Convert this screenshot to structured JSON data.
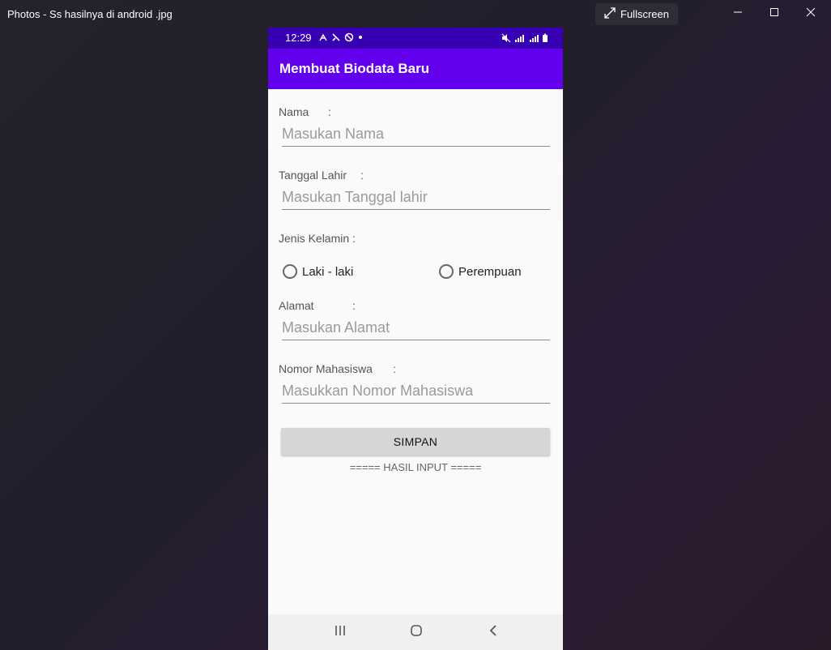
{
  "window": {
    "title": "Photos - Ss hasilnya di android .jpg",
    "fullscreen_label": "Fullscreen",
    "controls": [
      "minimize-icon",
      "maximize-icon",
      "close-icon"
    ]
  },
  "phone": {
    "status_bar": {
      "time": "12:29",
      "left_icons": [
        "accessibility-icon",
        "tools-icon",
        "sync-icon",
        "dot-icon"
      ],
      "right_icons": [
        "mute-icon",
        "signal-icon",
        "4g-signal-icon",
        "battery-icon"
      ]
    },
    "app_bar": {
      "title": "Membuat Biodata Baru"
    },
    "form": {
      "nama": {
        "label": "Nama",
        "colon": ":",
        "placeholder": "Masukan Nama",
        "value": ""
      },
      "tanggal_lahir": {
        "label": "Tanggal Lahir",
        "colon": ":",
        "placeholder": "Masukan Tanggal lahir",
        "value": ""
      },
      "jenis_kelamin": {
        "label": "Jenis Kelamin :",
        "options": [
          {
            "label": "Laki - laki",
            "checked": false
          },
          {
            "label": "Perempuan",
            "checked": false
          }
        ]
      },
      "alamat": {
        "label": "Alamat",
        "colon": ":",
        "placeholder": "Masukan Alamat",
        "value": ""
      },
      "nomor_mahasiswa": {
        "label": "Nomor Mahasiswa",
        "colon": ":",
        "placeholder": "Masukkan Nomor Mahasiswa",
        "value": ""
      },
      "save_label": "SIMPAN",
      "result_label": "===== HASIL INPUT ====="
    },
    "nav_bar": [
      "recent-apps-icon",
      "home-icon",
      "back-icon"
    ],
    "colors": {
      "status_bar": "#3700b3",
      "app_bar": "#6200ee",
      "background": "#fafafa",
      "button": "#d6d6d6"
    }
  }
}
